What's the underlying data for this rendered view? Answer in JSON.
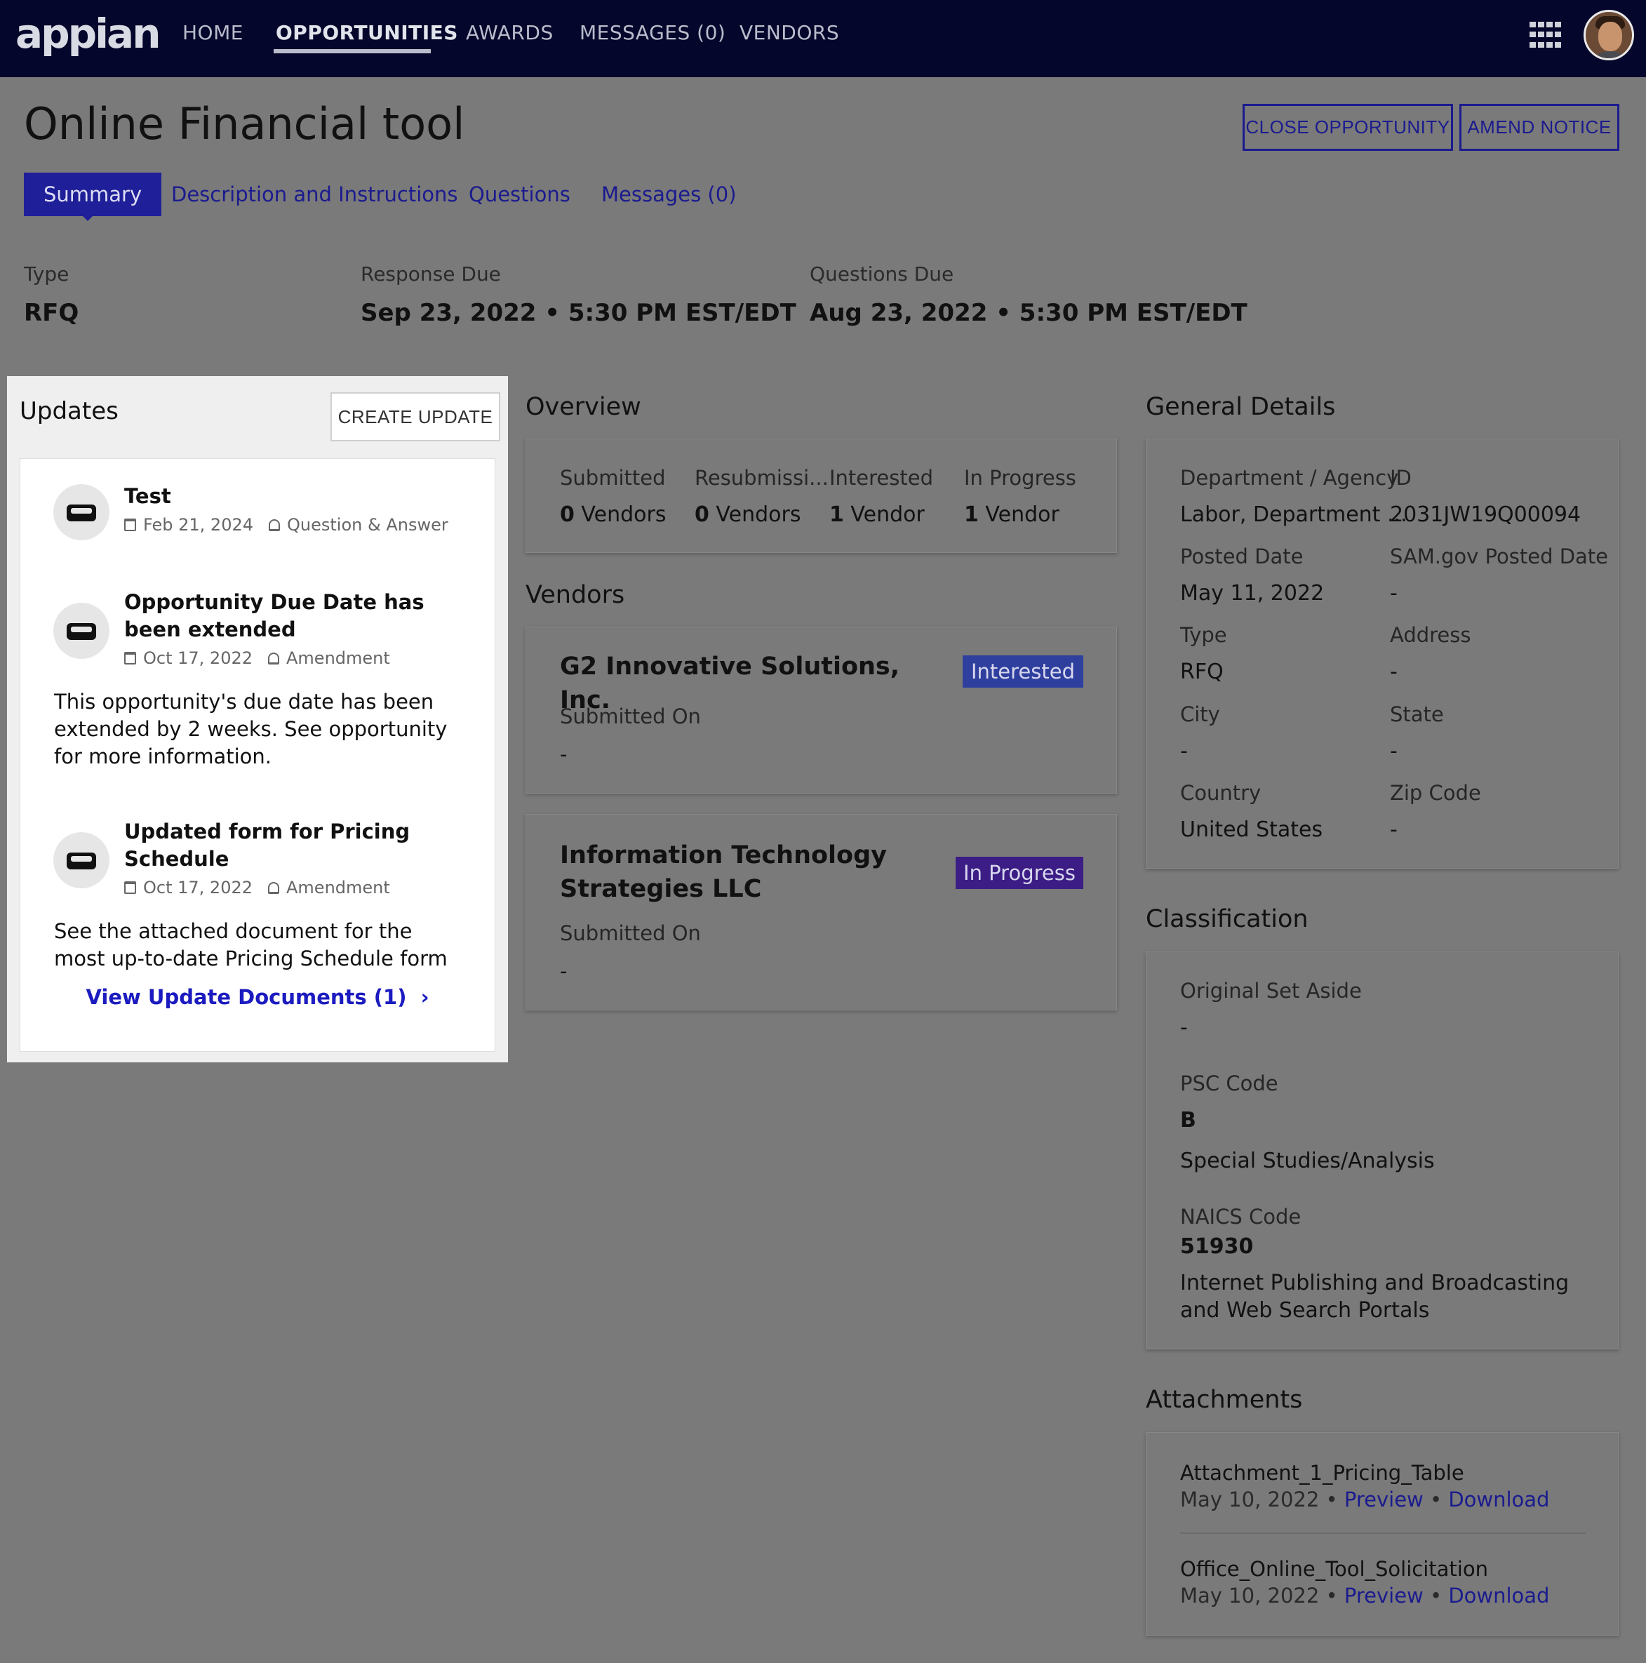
{
  "nav": {
    "logo": "appian",
    "items": [
      {
        "label": "HOME"
      },
      {
        "label": "OPPORTUNITIES",
        "active": true
      },
      {
        "label": "AWARDS"
      },
      {
        "label": "MESSAGES (0)"
      },
      {
        "label": "VENDORS"
      }
    ],
    "apps_icon": "grid-icon",
    "avatar_icon": "user-avatar"
  },
  "page": {
    "title": "Online Financial tool",
    "close_button": "CLOSE OPPORTUNITY",
    "amend_button": "AMEND NOTICE",
    "tabs": [
      {
        "label": "Summary",
        "active": true
      },
      {
        "label": "Description and Instructions"
      },
      {
        "label": "Questions"
      },
      {
        "label": "Messages (0)"
      }
    ]
  },
  "key_facts": {
    "type_label": "Type",
    "type_value": "RFQ",
    "response_label": "Response Due",
    "response_value": "Sep 23, 2022 • 5:30 PM EST/EDT",
    "questions_label": "Questions Due",
    "questions_value": "Aug 23, 2022 • 5:30 PM EST/EDT"
  },
  "updates": {
    "title": "Updates",
    "create_button": "CREATE UPDATE",
    "items": [
      {
        "title": "Test",
        "date": "Feb 21, 2024",
        "category": "Question & Answer",
        "body": ""
      },
      {
        "title": "Opportunity Due Date has been extended",
        "date": "Oct 17, 2022",
        "category": "Amendment",
        "body": "This opportunity's due date has been extended by 2 weeks. See opportunity for more information."
      },
      {
        "title": "Updated form for Pricing Schedule",
        "date": "Oct 17, 2022",
        "category": "Amendment",
        "body": "See the attached document for the most up-to-date Pricing Schedule form"
      }
    ],
    "view_link": "View Update Documents (1)",
    "view_link_chevron": "›"
  },
  "overview": {
    "title": "Overview",
    "stats": [
      {
        "label": "Submitted",
        "count": "0",
        "unit": "Vendors"
      },
      {
        "label": "Resubmissi...",
        "count": "0",
        "unit": "Vendors"
      },
      {
        "label": "Interested",
        "count": "1",
        "unit": "Vendor"
      },
      {
        "label": "In Progress",
        "count": "1",
        "unit": "Vendor"
      }
    ]
  },
  "vendors": {
    "title": "Vendors",
    "items": [
      {
        "name": "G2 Innovative Solutions, Inc.",
        "status": "Interested",
        "status_color": "#2e3f9e",
        "submitted_label": "Submitted On",
        "submitted_value": "-"
      },
      {
        "name": "Information Technology Strategies LLC",
        "status": "In Progress",
        "status_color": "#3c1d85",
        "submitted_label": "Submitted On",
        "submitted_value": "-"
      }
    ]
  },
  "general": {
    "title": "General Details",
    "fields": [
      {
        "label": "Department / Agency",
        "value": "Labor, Department ..."
      },
      {
        "label": "ID",
        "value": "2031JW19Q00094"
      },
      {
        "label": "Posted Date",
        "value": "May 11, 2022"
      },
      {
        "label": "SAM.gov Posted Date",
        "value": "-"
      },
      {
        "label": "Type",
        "value": "RFQ"
      },
      {
        "label": "Address",
        "value": "-"
      },
      {
        "label": "City",
        "value": "-"
      },
      {
        "label": "State",
        "value": "-"
      },
      {
        "label": "Country",
        "value": "United States"
      },
      {
        "label": "Zip Code",
        "value": "-"
      }
    ]
  },
  "classification": {
    "title": "Classification",
    "set_aside_label": "Original Set Aside",
    "set_aside_value": "-",
    "psc_label": "PSC Code",
    "psc_code": "B",
    "psc_desc": "Special Studies/Analysis",
    "naics_label": "NAICS Code",
    "naics_code": "51930",
    "naics_desc": "Internet Publishing and Broadcasting and Web Search Portals"
  },
  "attachments": {
    "title": "Attachments",
    "items": [
      {
        "name": "Attachment_1_Pricing_Table",
        "date": "May 10, 2022",
        "preview": "Preview",
        "download": "Download"
      },
      {
        "name": "Office_Online_Tool_Solicitation",
        "date": "May 10, 2022",
        "preview": "Preview",
        "download": "Download"
      }
    ],
    "separator": "•"
  },
  "colors": {
    "nav_bg": "#05062b",
    "accent": "#1f1f9a",
    "overlay": "#7a7a7a",
    "link": "#1b1bc0"
  }
}
